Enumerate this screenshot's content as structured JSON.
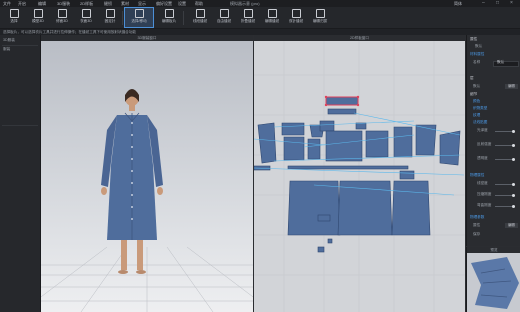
{
  "window": {
    "title": "模拟器示意 (pro)",
    "right_label": "简体"
  },
  "menu": {
    "items": [
      "文件",
      "开启",
      "编辑",
      "3D服装",
      "2D样板",
      "缝纫",
      "素材",
      "显示",
      "偏好设置",
      "设置",
      "帮助"
    ]
  },
  "toolbar": {
    "tools": [
      {
        "label": "选择"
      },
      {
        "label": "模型3D"
      },
      {
        "label": "修面3D"
      },
      {
        "label": "衣面3D"
      },
      {
        "label": "固定针"
      },
      {
        "label": "选择/移动"
      },
      {
        "label": "编辑板片"
      },
      {
        "label": "线段缝纫"
      },
      {
        "label": "自由缝纫"
      },
      {
        "label": "折叠缝纫"
      },
      {
        "label": "编辑缝纫"
      },
      {
        "label": "双针缝纫"
      },
      {
        "label": "编辑归拔"
      }
    ]
  },
  "hint": {
    "text": "选择板片，可以选择衣片工具并进行拉伸操作；在缝纫工具下可使用放射状缝合功能"
  },
  "left_panel": {
    "rows": [
      "3D服装",
      "服装"
    ]
  },
  "views": {
    "avatar_title": "3D服装窗口",
    "pattern_title": "2D样板窗口"
  },
  "properties": {
    "header": "属性",
    "tab": "默认",
    "fabric_label": "材料属性",
    "name_label": "名称",
    "name_value": "默认",
    "layer_label": "层",
    "details_label": "细节",
    "sec_physics": "物理属性",
    "rows": [
      {
        "label": "默认",
        "button": "编辑"
      },
      {
        "label": "颜色"
      },
      {
        "label": "织物类型"
      },
      {
        "label": "纹理"
      },
      {
        "label": "法线贴图"
      },
      {
        "label": "置换贴图"
      }
    ],
    "sliders": [
      {
        "label": "光泽度",
        "value": 0.85
      },
      {
        "label": "反射强度",
        "value": 0.85
      },
      {
        "label": "透明度",
        "value": 0.85
      }
    ],
    "physics_rows": [
      {
        "label": "线密度",
        "value": 0.85
      },
      {
        "label": "压缩刚度",
        "value": 0.85
      },
      {
        "label": "弯曲刚度",
        "value": 0.85
      }
    ],
    "bottom_label": "物理参数",
    "bottom_row": "属性",
    "bottom_button": "编辑",
    "save_label": "保存"
  },
  "thumbnail": {
    "title": "预览"
  }
}
